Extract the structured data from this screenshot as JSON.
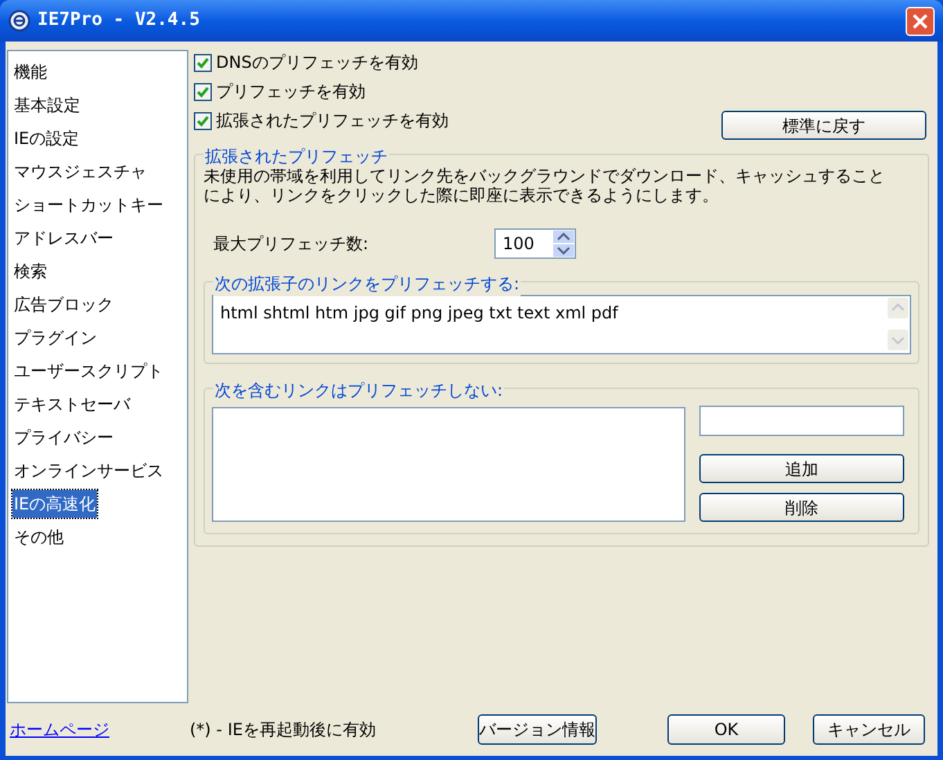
{
  "window": {
    "title": "IE7Pro - V2.4.5"
  },
  "sidebar": {
    "items": [
      {
        "label": "機能",
        "selected": false
      },
      {
        "label": "基本設定",
        "selected": false
      },
      {
        "label": "IEの設定",
        "selected": false
      },
      {
        "label": "マウスジェスチャ",
        "selected": false
      },
      {
        "label": "ショートカットキー",
        "selected": false
      },
      {
        "label": "アドレスバー",
        "selected": false
      },
      {
        "label": "検索",
        "selected": false
      },
      {
        "label": "広告ブロック",
        "selected": false
      },
      {
        "label": "プラグイン",
        "selected": false
      },
      {
        "label": "ユーザースクリプト",
        "selected": false
      },
      {
        "label": "テキストセーバ",
        "selected": false
      },
      {
        "label": "プライバシー",
        "selected": false
      },
      {
        "label": "オンラインサービス",
        "selected": false
      },
      {
        "label": "IEの高速化",
        "selected": true
      },
      {
        "label": "その他",
        "selected": false
      }
    ]
  },
  "checkboxes": [
    {
      "label": "DNSのプリフェッチを有効",
      "checked": true
    },
    {
      "label": "プリフェッチを有効",
      "checked": true
    },
    {
      "label": "拡張されたプリフェッチを有効",
      "checked": true
    }
  ],
  "reset_button": "標準に戻す",
  "extended_group": {
    "title": "拡張されたプリフェッチ",
    "description": "未使用の帯域を利用してリンク先をバックグラウンドでダウンロード、キャッシュすることにより、リンクをクリックした際に即座に表示できるようにします。",
    "max_label": "最大プリフェッチ数:",
    "max_value": "100",
    "extensions": {
      "title": "次の拡張子のリンクをプリフェッチする:",
      "value": "html shtml htm jpg gif png jpeg txt text xml pdf"
    },
    "exclude": {
      "title": "次を含むリンクはプリフェッチしない:",
      "add_button": "追加",
      "delete_button": "削除"
    }
  },
  "footer": {
    "homepage_link": "ホームページ",
    "note": "(*) - IEを再起動後に有効",
    "version_button": "バージョン情報",
    "ok_button": "OK",
    "cancel_button": "キャンセル"
  }
}
